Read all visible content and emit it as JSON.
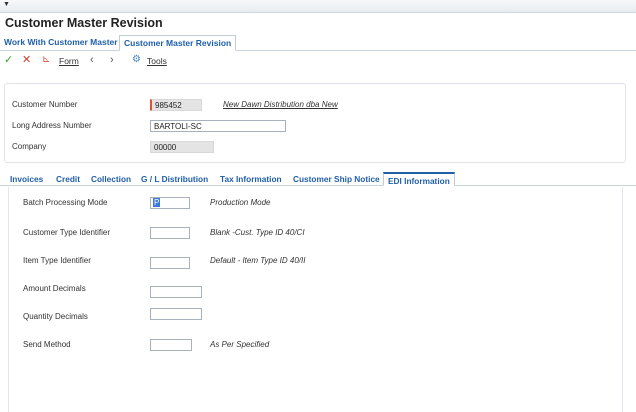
{
  "window": {
    "title": "Customer Master Revision"
  },
  "app_tabs": [
    {
      "label": "Work With Customer Master",
      "active": false
    },
    {
      "label": "Customer Master Revision",
      "active": true
    }
  ],
  "toolbar": {
    "ok_icon": "check-icon",
    "cancel_icon": "close-icon",
    "form_label": "Form",
    "tools_label": "Tools"
  },
  "header": {
    "customer_number": {
      "label": "Customer Number",
      "value": "985452",
      "description": "New Dawn Distribution dba New"
    },
    "long_address": {
      "label": "Long Address Number",
      "value": "BARTOLI-SC"
    },
    "company": {
      "label": "Company",
      "value": "00000"
    }
  },
  "section_tabs": [
    {
      "label": "Invoices",
      "active": false
    },
    {
      "label": "Credit",
      "active": false
    },
    {
      "label": "Collection",
      "active": false
    },
    {
      "label": "G / L Distribution",
      "active": false
    },
    {
      "label": "Tax Information",
      "active": false
    },
    {
      "label": "Customer Ship Notice",
      "active": false
    },
    {
      "label": "EDI Information",
      "active": true
    }
  ],
  "edi": {
    "batch_mode": {
      "label": "Batch Processing Mode",
      "value": "P",
      "description": "Production Mode"
    },
    "customer_type": {
      "label": "Customer Type Identifier",
      "value": "",
      "description": "Blank -Cust. Type ID 40/CI"
    },
    "item_type": {
      "label": "Item Type Identifier",
      "value": "",
      "description": "Default - Item Type ID 40/II"
    },
    "amount_decimals": {
      "label": "Amount Decimals",
      "value": ""
    },
    "quantity_decimals": {
      "label": "Quantity Decimals",
      "value": ""
    },
    "send_method": {
      "label": "Send Method",
      "value": "",
      "description": "As Per Specified"
    }
  },
  "colors": {
    "accent": "#1f5fa8",
    "ok": "#3aa33a",
    "cancel": "#d13b2e"
  }
}
